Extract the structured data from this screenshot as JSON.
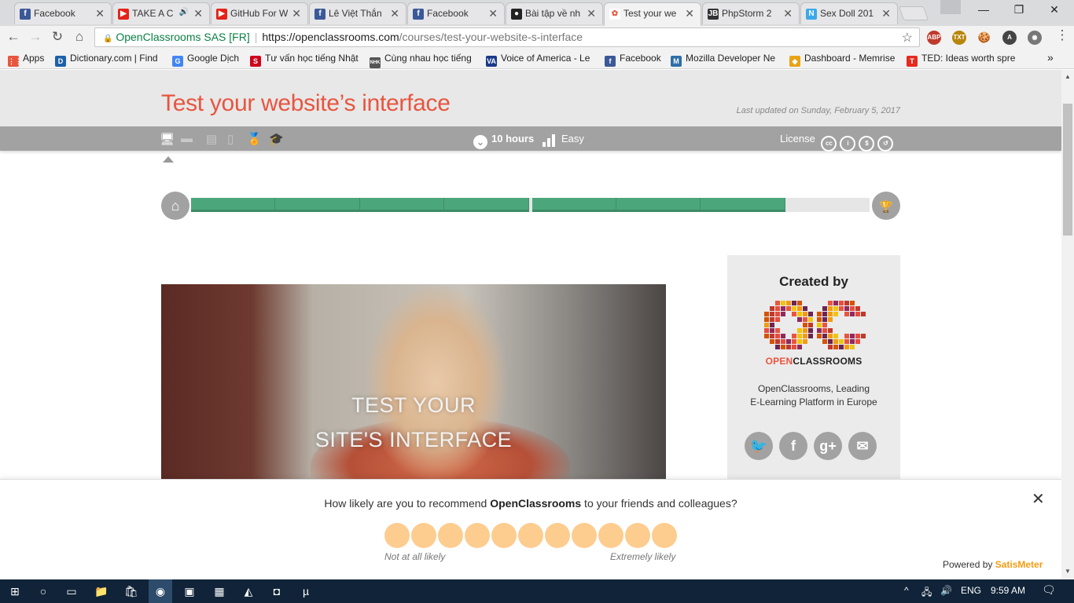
{
  "browser": {
    "tabs": [
      {
        "label": "Facebook",
        "icon": "facebook-icon",
        "color": "#3b5998",
        "glyph": "f"
      },
      {
        "label": "TAKE A C",
        "icon": "youtube-icon",
        "color": "#e62117",
        "glyph": "▶",
        "audio": "🔊"
      },
      {
        "label": "GitHub For W",
        "icon": "youtube-icon",
        "color": "#e62117",
        "glyph": "▶"
      },
      {
        "label": "Lê Việt Thắn",
        "icon": "facebook-icon",
        "color": "#3b5998",
        "glyph": "f"
      },
      {
        "label": "Facebook",
        "icon": "facebook-icon",
        "color": "#3b5998",
        "glyph": "f"
      },
      {
        "label": "Bài tập về nh",
        "icon": "github-icon",
        "color": "#222222",
        "glyph": "●"
      },
      {
        "label": "Test your we",
        "icon": "openclassrooms-icon",
        "color": "#e8553f",
        "glyph": "✿"
      },
      {
        "label": "PhpStorm 2",
        "icon": "phpstorm-icon",
        "color": "#333333",
        "glyph": "JB"
      },
      {
        "label": "Sex Doll 201",
        "icon": "n-icon",
        "color": "#3ba9e8",
        "glyph": "N"
      }
    ],
    "close_glyph": "✕",
    "window_controls": {
      "minimize": "—",
      "maximize": "❐",
      "close": "✕"
    },
    "nav": {
      "back": "←",
      "forward": "→",
      "reload": "↻",
      "home": "⌂"
    },
    "omnibox": {
      "lock": "🔒",
      "secure_label": "OpenClassrooms SAS [FR]",
      "url_host": "https://openclassrooms.com",
      "url_path": "/courses/test-your-website-s-interface",
      "star": "☆"
    },
    "extensions": [
      {
        "name": "adblock-icon",
        "glyph": "ABP",
        "color": "#c0392b"
      },
      {
        "name": "txt-extension-icon",
        "glyph": "TXT",
        "color": "#b8860b"
      },
      {
        "name": "cookie-icon",
        "glyph": "🍪",
        "color": "#f2f2f2"
      },
      {
        "name": "a-extension-icon",
        "glyph": "A",
        "color": "#444444"
      },
      {
        "name": "camera-icon",
        "glyph": "◉",
        "color": "#777777"
      }
    ],
    "menu": "⋮",
    "bookmarks": [
      {
        "label": "Apps",
        "icon": "apps-icon",
        "color": "#e8553f",
        "glyph": "⋮⋮"
      },
      {
        "label": "Dictionary.com | Find",
        "icon": "dictionary-icon",
        "color": "#1f5fa8",
        "glyph": "D"
      },
      {
        "label": "Google Dịch",
        "icon": "google-translate-icon",
        "color": "#4285f4",
        "glyph": "G"
      },
      {
        "label": "Tư vấn học tiếng Nhật",
        "icon": "tuvan-icon",
        "color": "#d0021b",
        "glyph": "S"
      },
      {
        "label": "Cùng nhau học tiếng",
        "icon": "nhk-icon",
        "color": "#555555",
        "glyph": "NHK"
      },
      {
        "label": "Voice of America - Le",
        "icon": "voa-icon",
        "color": "#1b3a8a",
        "glyph": "VA"
      },
      {
        "label": "Facebook",
        "icon": "facebook-icon",
        "color": "#3b5998",
        "glyph": "f"
      },
      {
        "label": "Mozilla Developer Ne",
        "icon": "mdn-icon",
        "color": "#2f6ea8",
        "glyph": "M"
      },
      {
        "label": "Dashboard - Memrise",
        "icon": "memrise-icon",
        "color": "#e8a317",
        "glyph": "◆"
      },
      {
        "label": "TED: Ideas worth spre",
        "icon": "ted-icon",
        "color": "#e62b1e",
        "glyph": "T"
      }
    ],
    "bookmarks_more": "»"
  },
  "course": {
    "title": "Test your website’s interface",
    "last_updated": "Last updated on Sunday, February 5, 2017",
    "media_types": [
      {
        "name": "text-course-icon",
        "glyph": "🖥",
        "active": true
      },
      {
        "name": "video-course-icon",
        "glyph": "▬",
        "active": false
      },
      {
        "name": "exercise-icon",
        "glyph": "▤",
        "active": false
      },
      {
        "name": "mobile-icon",
        "glyph": "▯",
        "active": false
      },
      {
        "name": "certificate-icon",
        "glyph": "🏅",
        "active": true
      },
      {
        "name": "graduation-cap-icon",
        "glyph": "🎓",
        "active": false
      }
    ],
    "duration": "10 hours",
    "clock_glyph": "⌄",
    "difficulty": "Easy",
    "license_label": "License",
    "license_icons": [
      {
        "name": "cc-icon",
        "glyph": "cc"
      },
      {
        "name": "by-icon",
        "glyph": "i"
      },
      {
        "name": "nc-icon",
        "glyph": "$"
      },
      {
        "name": "sa-icon",
        "glyph": "↺"
      }
    ],
    "progress": {
      "home_glyph": "⌂",
      "trophy_glyph": "🏆",
      "fraction_complete": 0.875,
      "parts": [
        4,
        4
      ],
      "segments_done": 7
    },
    "video_title_line1": "TEST YOUR",
    "video_title_line2": "SITE'S INTERFACE"
  },
  "creator": {
    "heading": "Created by",
    "wordmark_open": "OPEN",
    "wordmark_rest": "CLASSROOMS",
    "description_line1": "OpenClassrooms, Leading",
    "description_line2": "E-Learning Platform in Europe",
    "social": [
      {
        "name": "twitter-icon",
        "glyph": "🐦"
      },
      {
        "name": "facebook-share-icon",
        "glyph": "f"
      },
      {
        "name": "google-plus-icon",
        "glyph": "g+"
      },
      {
        "name": "email-icon",
        "glyph": "✉"
      }
    ]
  },
  "survey": {
    "question_prefix": "How likely are you to recommend ",
    "question_brand": "OpenClassrooms",
    "question_suffix": " to your friends and colleagues?",
    "scale_count": 11,
    "low_label": "Not at all likely",
    "high_label": "Extremely likely",
    "powered_by": "Powered by ",
    "powered_brand": "SatisMeter",
    "close_glyph": "✕"
  },
  "taskbar": {
    "apps": [
      {
        "name": "windows-start-icon",
        "glyph": "⊞"
      },
      {
        "name": "cortana-icon",
        "glyph": "○"
      },
      {
        "name": "task-view-icon",
        "glyph": "▭"
      },
      {
        "name": "file-explorer-icon",
        "glyph": "📁"
      },
      {
        "name": "store-icon",
        "glyph": "🛍"
      },
      {
        "name": "chrome-icon",
        "glyph": "◉"
      },
      {
        "name": "app-icon-1",
        "glyph": "▣"
      },
      {
        "name": "app-icon-2",
        "glyph": "▦"
      },
      {
        "name": "app-icon-3",
        "glyph": "◭"
      },
      {
        "name": "app-icon-4",
        "glyph": "◘"
      },
      {
        "name": "utorrent-icon",
        "glyph": "µ"
      }
    ],
    "tray": {
      "chevron": "^",
      "network": "🖧",
      "volume": "🔊",
      "lang": "ENG",
      "time": "9:59 AM",
      "notif": "🗨"
    }
  }
}
